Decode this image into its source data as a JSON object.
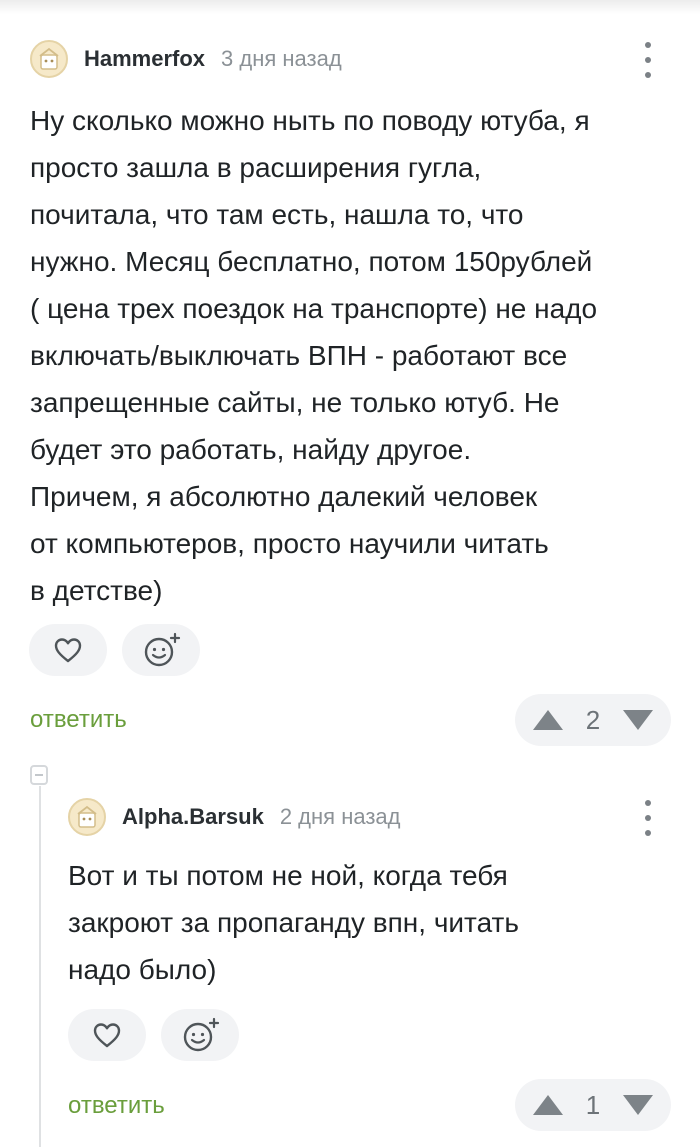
{
  "comments": [
    {
      "author": "Hammerfox",
      "date": "3 дня назад",
      "lines": [
        "Ну сколько можно ныть по поводу ютуба, я",
        "просто зашла в расширения гугла,",
        "почитала, что там есть, нашла то, что",
        "нужно. Месяц бесплатно, потом 150рублей",
        "( цена трех поездок на транспорте) не надо",
        "включать/выключать ВПН - работают все",
        "запрещенные сайты, не только ютуб. Не",
        "будет это работать, найду другое.",
        "Причем, я абсолютно далекий человек",
        "от компьютеров, просто научили читать",
        "в детстве)"
      ],
      "reply_label": "ответить",
      "rating": "2"
    },
    {
      "author": "Alpha.Barsuk",
      "date": "2 дня назад",
      "lines": [
        "Вот и ты потом не ной, когда тебя",
        "закроют за пропаганду впн, читать",
        "надо было)"
      ],
      "reply_label": "ответить",
      "rating": "1"
    }
  ],
  "icons": {
    "avatar": "default-avatar-icon",
    "more": "more-vertical-icon",
    "like": "heart-icon",
    "react": "add-emoji-icon",
    "upvote": "upvote-icon",
    "downvote": "downvote-icon",
    "collapse": "collapse-thread-icon"
  },
  "colors": {
    "accent": "#6a9e3c",
    "pill_bg": "#f2f3f5",
    "muted": "#8b9196"
  }
}
